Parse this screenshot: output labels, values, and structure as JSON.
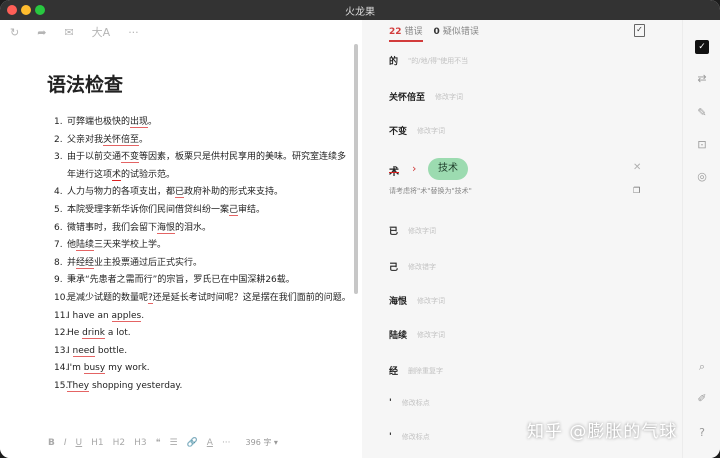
{
  "window": {
    "title": "火龙果"
  },
  "toolbar": {
    "refresh_icon": "↻",
    "share_icon": "➦",
    "mail_icon": "✉",
    "font_icon": "大A",
    "more_icon": "···"
  },
  "document": {
    "title": "语法检查",
    "items": [
      {
        "num": "1.",
        "parts": [
          {
            "t": "可弊端也极快的"
          },
          {
            "t": "出现",
            "e": 1
          },
          {
            "t": "。"
          }
        ]
      },
      {
        "num": "2.",
        "parts": [
          {
            "t": "父亲对我"
          },
          {
            "t": "关怀倍至",
            "e": 1
          },
          {
            "t": "。"
          }
        ]
      },
      {
        "num": "3.",
        "parts": [
          {
            "t": "由于以前交通"
          },
          {
            "t": "不变",
            "e": 1
          },
          {
            "t": "等因素，板栗只是供村民享用的美味。研究室连续多年进行这项"
          },
          {
            "t": "术",
            "e": 2
          },
          {
            "t": "的试验示范。"
          }
        ]
      },
      {
        "num": "4.",
        "parts": [
          {
            "t": "人力与物力的各项支出，都"
          },
          {
            "t": "已",
            "e": 1
          },
          {
            "t": "政府补助的形式来支持。"
          }
        ]
      },
      {
        "num": "5.",
        "parts": [
          {
            "t": "本院受理李新华诉你们民间借贷纠纷一案"
          },
          {
            "t": "己",
            "e": 1
          },
          {
            "t": "审结。"
          }
        ]
      },
      {
        "num": "6.",
        "parts": [
          {
            "t": "微错事时，我们会留下"
          },
          {
            "t": "海恨",
            "e": 1
          },
          {
            "t": "的泪水。"
          }
        ]
      },
      {
        "num": "7.",
        "parts": [
          {
            "t": "他"
          },
          {
            "t": "陆续",
            "e": 1
          },
          {
            "t": "三天来学校上学。"
          }
        ]
      },
      {
        "num": "8.",
        "parts": [
          {
            "t": "并"
          },
          {
            "t": "经经",
            "e": 1
          },
          {
            "t": "业主投票通过后正式实行。"
          }
        ]
      },
      {
        "num": "9.",
        "parts": [
          {
            "t": "秉承“先患者之需而行”的宗旨，罗氏已在中国深耕26载。"
          }
        ]
      },
      {
        "num": "10.",
        "parts": [
          {
            "t": "是减少试题的数量呢"
          },
          {
            "t": "?",
            "e": 1
          },
          {
            "t": "还是延长考试时间呢？这是摆在我们面前的问题。"
          }
        ]
      },
      {
        "num": "11.",
        "parts": [
          {
            "t": "I have an "
          },
          {
            "t": "apples",
            "e": 1
          },
          {
            "t": "."
          }
        ]
      },
      {
        "num": "12.",
        "parts": [
          {
            "t": "He "
          },
          {
            "t": "drink",
            "e": 1
          },
          {
            "t": " a lot."
          }
        ]
      },
      {
        "num": "13.",
        "parts": [
          {
            "t": "I "
          },
          {
            "t": "need",
            "e": 1
          },
          {
            "t": " bottle."
          }
        ]
      },
      {
        "num": "14.",
        "parts": [
          {
            "t": "I'm "
          },
          {
            "t": "busy",
            "e": 1
          },
          {
            "t": " my work."
          }
        ]
      },
      {
        "num": "15.",
        "parts": [
          {
            "t": "They",
            "e": 1
          },
          {
            "t": " shopping yesterday."
          }
        ]
      }
    ]
  },
  "format_bar": {
    "bold": "B",
    "italic": "I",
    "underline": "U",
    "h1": "H1",
    "h2": "H2",
    "h3": "H3",
    "quote": "❝",
    "list": "☰",
    "link": "🔗",
    "clear": "A",
    "more": "···",
    "word_count": "396 字 ▾"
  },
  "panel": {
    "tab_errors": {
      "count": "22",
      "label": "错误"
    },
    "tab_suspect": {
      "count": "0",
      "label": "疑似错误"
    },
    "issues": [
      {
        "word": "的",
        "hint": "\"的/地/得\"使用不当"
      },
      {
        "word": "关怀倍至",
        "hint": "修改字词"
      },
      {
        "word": "不变",
        "hint": "修改字词"
      }
    ],
    "selected": {
      "word": "术",
      "arrow": "›",
      "suggestion": "技术",
      "hint": "请考虑将\"术\"替换为\"技术\""
    },
    "issues_after": [
      {
        "word": "已",
        "hint": "修改字词"
      },
      {
        "word": "己",
        "hint": "修改错字"
      },
      {
        "word": "海恨",
        "hint": "修改字词"
      },
      {
        "word": "陆续",
        "hint": "修改字词"
      },
      {
        "word": "经",
        "hint": "删除重复字"
      },
      {
        "word": "'",
        "hint": "修改标点"
      },
      {
        "word": "'",
        "hint": "修改标点"
      }
    ]
  },
  "rail": {
    "check_icon": "✓",
    "translate_icon": "⇄",
    "rewrite_icon": "✎",
    "box_icon": "⊡",
    "compass_icon": "◎",
    "search_doc_icon": "⌕",
    "edit_doc_icon": "✐",
    "help_icon": "?"
  },
  "watermark": "知乎 @膨胀的气球"
}
